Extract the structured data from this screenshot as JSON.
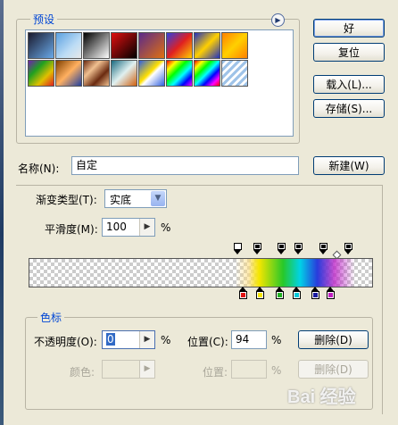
{
  "presets": {
    "legend": "预设",
    "swatches": [
      {
        "name": "swatch-1",
        "css": "linear-gradient(135deg,#1a1a2e,#6aa9e8)"
      },
      {
        "name": "swatch-2",
        "css": "linear-gradient(135deg,#5aa0e0 0%,#bcdcf5 60%,#e8e8e8 100%)"
      },
      {
        "name": "swatch-3",
        "css": "linear-gradient(135deg,#000,#fff)"
      },
      {
        "name": "swatch-4",
        "css": "linear-gradient(135deg,#e01010,#000)"
      },
      {
        "name": "swatch-5",
        "css": "linear-gradient(135deg,#5a2a8a,#e07010)"
      },
      {
        "name": "swatch-6",
        "css": "linear-gradient(135deg,#3040e0,#e02020,#ffd000)"
      },
      {
        "name": "swatch-7",
        "css": "linear-gradient(135deg,#2030c0,#ffd000,#2030c0)"
      },
      {
        "name": "swatch-8",
        "css": "linear-gradient(135deg,#ff8000,#ffd000,#ff8000)"
      },
      {
        "name": "swatch-9",
        "css": "linear-gradient(135deg,#7020b0,#20a020,#e0c000,#e02020)"
      },
      {
        "name": "swatch-10",
        "css": "linear-gradient(135deg,#804000,#ffb060,#2040a0)"
      },
      {
        "name": "swatch-11",
        "css": "linear-gradient(135deg,#6a2a10,#f0c090,#6a2a10,#f0c090)"
      },
      {
        "name": "swatch-12",
        "css": "linear-gradient(135deg,#1a6a80,#e0f0f0,#d06010)"
      },
      {
        "name": "swatch-13",
        "css": "linear-gradient(135deg,#3060e0,#ffe000 45%,#fff 55%,#3060e0)"
      },
      {
        "name": "swatch-14",
        "css": "linear-gradient(135deg,#ff0000,#ffff00,#00ff00,#00ffff,#0000ff,#ff00ff)"
      },
      {
        "name": "swatch-15",
        "css": "linear-gradient(135deg,#ff0000,#ffff00,#00ff00,#00ffff,#0000ff,#ff00ff,#ff0000)"
      },
      {
        "name": "swatch-16",
        "css": "repeating-linear-gradient(135deg,#9fc3e8 0 3px,#ffffff 3px 6px)"
      }
    ]
  },
  "buttons": {
    "ok": "好",
    "reset": "复位",
    "load": "载入(L)...",
    "save": "存储(S)...",
    "new": "新建(W)",
    "delete": "删除(D)",
    "delete_disabled": "删除(D)"
  },
  "name_field": {
    "label": "名称(N):",
    "value": "自定"
  },
  "gradient_type": {
    "label": "渐变类型(T):",
    "value": "实底"
  },
  "smoothness": {
    "label": "平滑度(M):",
    "value": "100",
    "unit": "%"
  },
  "color_stops_group": {
    "legend": "色标",
    "opacity_label": "不透明度(O):",
    "opacity_value": "0",
    "opacity_unit": "%",
    "position_label": "位置(C):",
    "position_value": "94",
    "position_unit": "%",
    "color_label": "颜色:",
    "position2_label": "位置:",
    "position2_unit": "%"
  },
  "colors": {
    "stops": [
      "#e01010",
      "#f5e400",
      "#20b020",
      "#00c8d8",
      "#1a1aa0",
      "#c020c0"
    ]
  },
  "watermark": "Bai 经验"
}
